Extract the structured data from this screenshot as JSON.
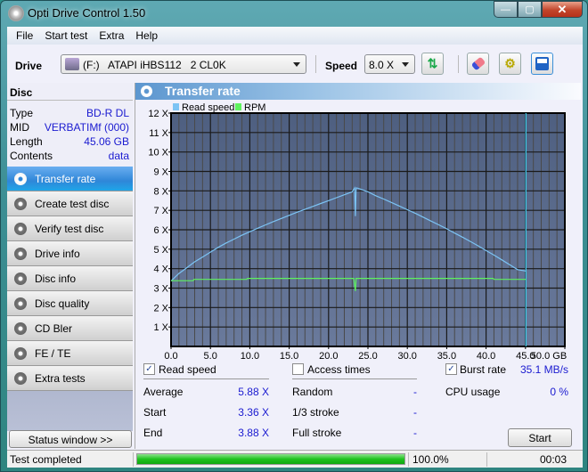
{
  "window": {
    "title": "Opti Drive Control 1.50",
    "minimize": "—",
    "maximize": "▢",
    "close": "✕"
  },
  "menu": [
    "File",
    "Start test",
    "Extra",
    "Help"
  ],
  "toolbar": {
    "drive_label": "Drive",
    "drive_value": "(F:)   ATAPI iHBS112   2 CL0K",
    "speed_label": "Speed",
    "speed_value": "8.0 X",
    "icons": [
      "refresh-icon",
      "eraser-icon",
      "settings-icon",
      "save-icon"
    ]
  },
  "disc": {
    "heading": "Disc",
    "rows": [
      {
        "label": "Type",
        "value": "BD-R DL"
      },
      {
        "label": "MID",
        "value": "VERBATIMf (000)"
      },
      {
        "label": "Length",
        "value": "45.06 GB"
      },
      {
        "label": "Contents",
        "value": "data"
      }
    ]
  },
  "nav": [
    {
      "label": "Transfer rate",
      "active": true
    },
    {
      "label": "Create test disc"
    },
    {
      "label": "Verify test disc"
    },
    {
      "label": "Drive info"
    },
    {
      "label": "Disc info"
    },
    {
      "label": "Disc quality"
    },
    {
      "label": "CD Bler"
    },
    {
      "label": "FE / TE"
    },
    {
      "label": "Extra tests"
    }
  ],
  "status_window_button": "Status window >>",
  "panel": {
    "title": "Transfer rate"
  },
  "chart_data": {
    "type": "line",
    "title": "Transfer rate",
    "xlabel": "GB",
    "ylabel": "",
    "xlim": [
      0,
      50
    ],
    "ylim": [
      0,
      12
    ],
    "x_ticks": [
      "0.0",
      "5.0",
      "10.0",
      "15.0",
      "20.0",
      "25.0",
      "30.0",
      "35.0",
      "40.0",
      "45.0",
      "50.0 GB"
    ],
    "y_ticks": [
      "1 X",
      "2 X",
      "3 X",
      "4 X",
      "5 X",
      "6 X",
      "7 X",
      "8 X",
      "9 X",
      "10 X",
      "11 X",
      "12 X"
    ],
    "legend": [
      "Read speed",
      "RPM"
    ],
    "legend_position": "top-left",
    "grid": true,
    "disc_end_marker": 45.06,
    "series": [
      {
        "name": "Read speed",
        "color": "#7cc4f4",
        "x": [
          0,
          1,
          2,
          3,
          4,
          5,
          6,
          7,
          8,
          9,
          10,
          11,
          12,
          13,
          14,
          15,
          16,
          17,
          18,
          19,
          20,
          21,
          22,
          23,
          23.3,
          23.4,
          23.5,
          23.6,
          24,
          25,
          26,
          27,
          28,
          29,
          30,
          31,
          32,
          33,
          34,
          35,
          36,
          37,
          38,
          39,
          40,
          41,
          42,
          43,
          44,
          45.06
        ],
        "y": [
          3.36,
          3.75,
          4.05,
          4.35,
          4.6,
          4.85,
          5.1,
          5.32,
          5.52,
          5.72,
          5.9,
          6.08,
          6.25,
          6.42,
          6.58,
          6.74,
          6.9,
          7.05,
          7.2,
          7.35,
          7.5,
          7.65,
          7.8,
          7.95,
          8.15,
          6.7,
          8.15,
          8.15,
          8.1,
          7.95,
          7.75,
          7.58,
          7.4,
          7.22,
          7.03,
          6.85,
          6.65,
          6.45,
          6.25,
          6.05,
          5.83,
          5.62,
          5.4,
          5.17,
          4.93,
          4.7,
          4.45,
          4.2,
          3.95,
          3.88
        ]
      },
      {
        "name": "RPM",
        "color": "#5ef25e",
        "x": [
          0,
          2.8,
          2.9,
          9.6,
          9.7,
          23.2,
          23.3,
          23.4,
          23.5,
          23.6,
          40.9,
          41.0,
          45.06
        ],
        "y": [
          3.38,
          3.38,
          3.45,
          3.45,
          3.5,
          3.5,
          3.15,
          2.85,
          3.5,
          3.5,
          3.5,
          3.45,
          3.45
        ]
      }
    ]
  },
  "stats": {
    "read_speed": {
      "label": "Read speed",
      "checked": true
    },
    "average": {
      "label": "Average",
      "value": "5.88 X"
    },
    "start": {
      "label": "Start",
      "value": "3.36 X"
    },
    "end": {
      "label": "End",
      "value": "3.88 X"
    },
    "access_times": {
      "label": "Access times",
      "checked": false
    },
    "random": {
      "label": "Random",
      "value": "-"
    },
    "one_third": {
      "label": "1/3 stroke",
      "value": "-"
    },
    "full_stroke": {
      "label": "Full stroke",
      "value": "-"
    },
    "burst_rate": {
      "label": "Burst rate",
      "value": "35.1 MB/s",
      "checked": true
    },
    "cpu_usage": {
      "label": "CPU usage",
      "value": "0 %"
    },
    "start_button": "Start"
  },
  "statusbar": {
    "text": "Test completed",
    "progress_percent": 100.0,
    "progress_label": "100.0%",
    "elapsed": "00:03"
  }
}
